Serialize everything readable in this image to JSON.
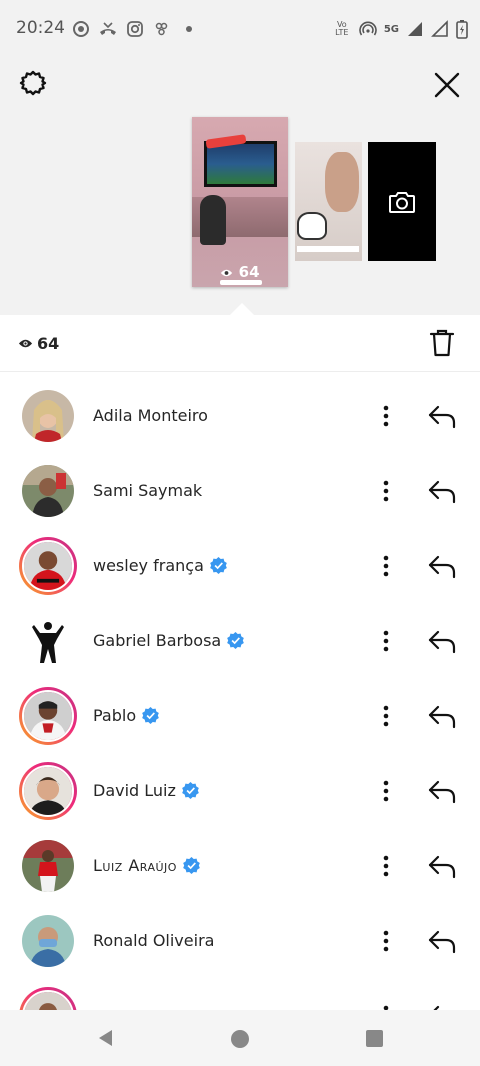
{
  "status_bar": {
    "time": "20:24",
    "network": "5G",
    "volte": "Vo LTE",
    "icons": [
      "screen-record-icon",
      "missed-call-icon",
      "instagram-icon",
      "app-notification-icon",
      "dot-icon",
      "volte-icon",
      "hotspot-icon",
      "signal-icon",
      "signal-icon",
      "battery-icon"
    ]
  },
  "preview": {
    "main_story_views": "64",
    "actions": [
      "settings",
      "close"
    ],
    "new_story_icon": "camera-icon"
  },
  "viewers_header": {
    "view_count": "64",
    "delete_icon": "trash-icon"
  },
  "viewers": [
    {
      "name": "Adila Monteiro",
      "verified": false,
      "ring": false
    },
    {
      "name": "Sami Saymak",
      "verified": false,
      "ring": false
    },
    {
      "name": "wesley frança",
      "verified": true,
      "ring": true
    },
    {
      "name": "Gabriel Barbosa",
      "verified": true,
      "ring": false
    },
    {
      "name": "Pablo",
      "verified": true,
      "ring": true
    },
    {
      "name": "David Luiz",
      "verified": true,
      "ring": true
    },
    {
      "name": "Luiz Araújo",
      "verified": true,
      "ring": false
    },
    {
      "name": "Ronald Oliveira",
      "verified": false,
      "ring": false
    },
    {
      "name": "",
      "verified": false,
      "ring": true
    }
  ],
  "colors": {
    "verified_blue": "#3897f0",
    "ring_start": "#f9a825",
    "ring_end": "#c13584",
    "background_gray": "#f2f2f2"
  }
}
